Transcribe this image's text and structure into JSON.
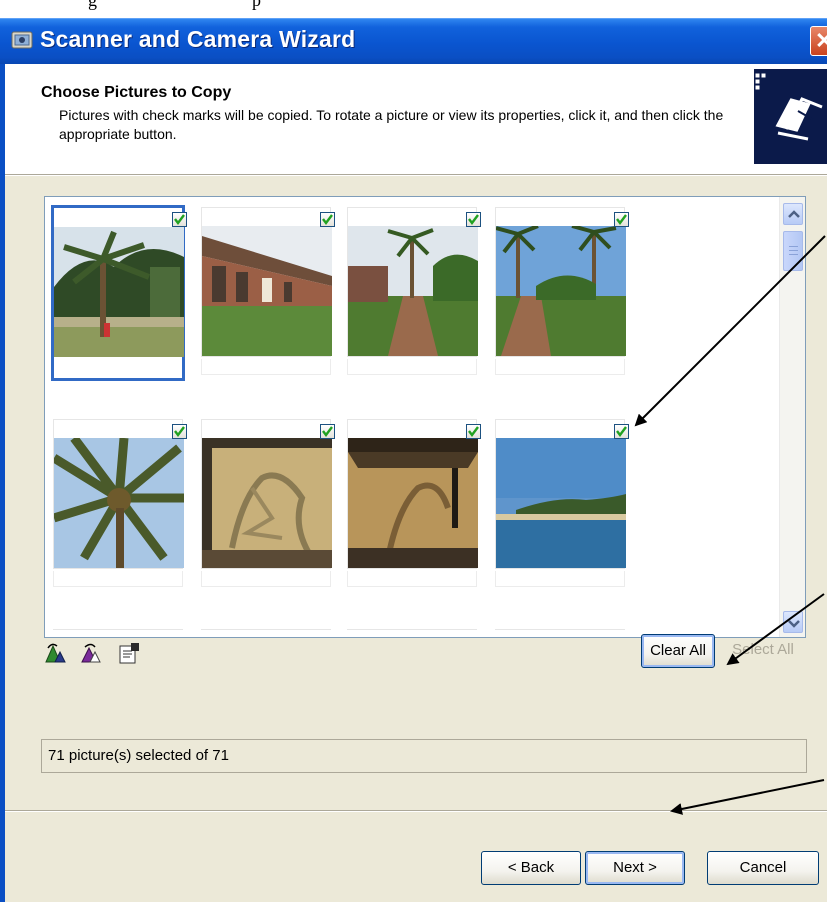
{
  "window": {
    "title": "Scanner and Camera Wizard",
    "close_glyph": "✕"
  },
  "header": {
    "title": "Choose Pictures to Copy",
    "description": "Pictures with check marks will be copied. To rotate a picture or view its properties, click it, and then click the appropriate button."
  },
  "thumbnails": [
    {
      "scene": "palm-yard-person",
      "checked": true,
      "selected": true
    },
    {
      "scene": "brick-building",
      "checked": true,
      "selected": false
    },
    {
      "scene": "garden-path",
      "checked": true,
      "selected": false
    },
    {
      "scene": "garden-path-2",
      "checked": true,
      "selected": false
    },
    {
      "scene": "palm-crown",
      "checked": true,
      "selected": false
    },
    {
      "scene": "shade-blind",
      "checked": true,
      "selected": false
    },
    {
      "scene": "shade-blind-2",
      "checked": true,
      "selected": false
    },
    {
      "scene": "beach-water",
      "checked": true,
      "selected": false
    }
  ],
  "toolbar": {
    "rotate_left_icon": "rotate-left-icon",
    "rotate_right_icon": "rotate-right-icon",
    "properties_icon": "properties-icon"
  },
  "selection_buttons": {
    "clear_all": "Clear All",
    "select_all": "Select All"
  },
  "status": {
    "text": "71 picture(s) selected of 71"
  },
  "nav_buttons": {
    "back": "< Back",
    "next": "Next >",
    "cancel": "Cancel"
  },
  "colors": {
    "titlebar": "#0a55d0",
    "selection_border": "#316ac5",
    "dialog_bg": "#ece9d8"
  }
}
